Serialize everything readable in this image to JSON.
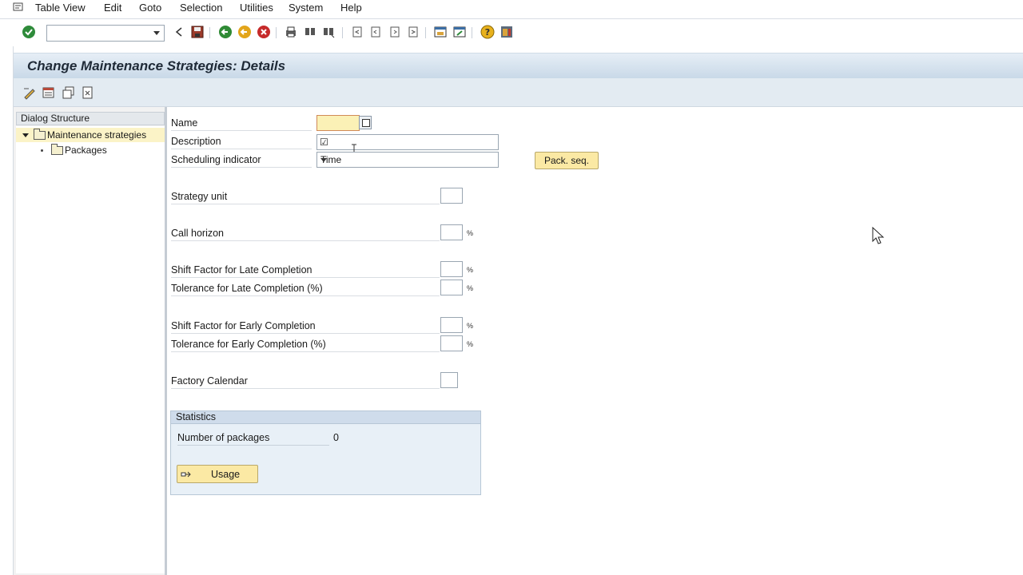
{
  "menu": {
    "items": [
      "Table View",
      "Edit",
      "Goto",
      "Selection",
      "Utilities",
      "System",
      "Help"
    ]
  },
  "toolbar": {
    "command_field_value": "",
    "icons": [
      "enter-icon",
      "back-icon",
      "save-icon",
      "back-arrow-icon",
      "exit-icon",
      "cancel-icon",
      "print-icon",
      "find-icon",
      "find-next-icon",
      "first-page-icon",
      "previous-page-icon",
      "next-page-icon",
      "last-page-icon",
      "create-session-icon",
      "shortcut-icon",
      "help-icon",
      "layout-menu-icon"
    ]
  },
  "title": "Change Maintenance Strategies: Details",
  "app_toolbar": {
    "icons": [
      "display-change-icon",
      "new-entries-icon",
      "copy-as-icon",
      "delete-icon"
    ]
  },
  "dialog_structure": {
    "header": "Dialog Structure",
    "items": [
      {
        "label": "Maintenance strategies",
        "selected": true
      },
      {
        "label": "Packages",
        "selected": false
      }
    ]
  },
  "form": {
    "name_label": "Name",
    "name_value": "",
    "description_label": "Description",
    "description_value": "☑",
    "scheduling_label": "Scheduling indicator",
    "scheduling_value": "Time",
    "pack_seq_button": "Pack. seq.",
    "strategy_unit_label": "Strategy unit",
    "call_horizon_label": "Call horizon",
    "shift_late_label": "Shift Factor for Late Completion",
    "tol_late_label": "Tolerance for Late Completion (%)",
    "shift_early_label": "Shift Factor for Early Completion",
    "tol_early_label": "Tolerance for Early Completion (%)",
    "factory_calendar_label": "Factory Calendar",
    "percent_unit": "%"
  },
  "statistics": {
    "header": "Statistics",
    "packages_label": "Number of packages",
    "packages_value": "0",
    "usage_button": "Usage"
  },
  "colors": {
    "title_bar": "#c9d9e8",
    "button_yellow": "#fbe9a4",
    "required_field": "#fbf1b6"
  }
}
